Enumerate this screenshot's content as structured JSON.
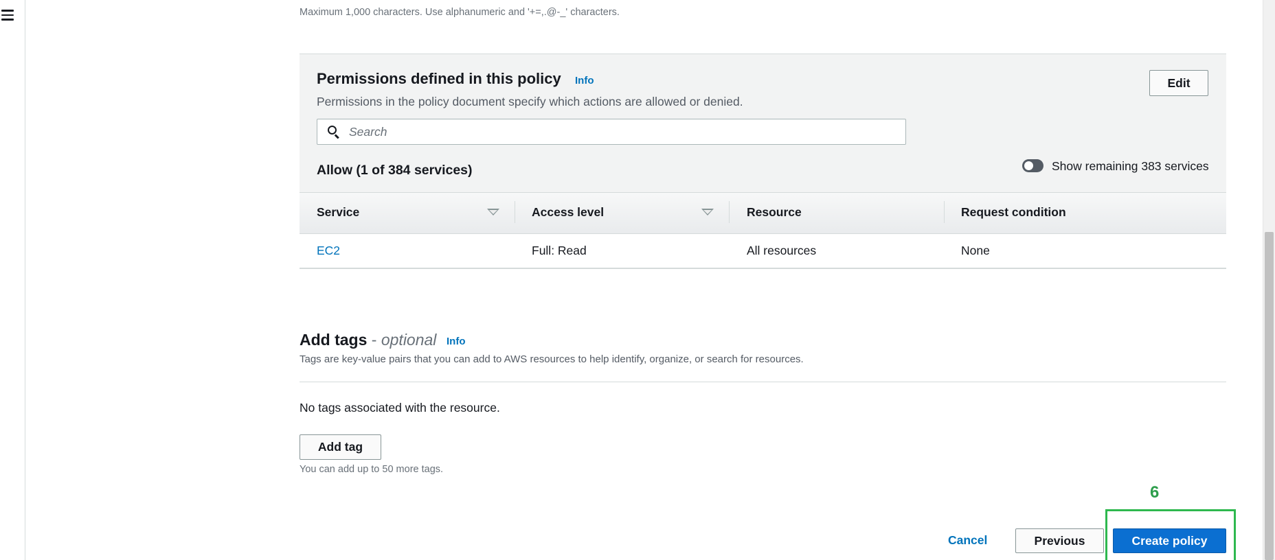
{
  "nav": {
    "menu_icon": "hamburger-menu-icon"
  },
  "description_hint": "Maximum 1,000 characters. Use alphanumeric and '+=,.@-_' characters.",
  "permissions": {
    "title": "Permissions defined in this policy",
    "info_label": "Info",
    "description": "Permissions in the policy document specify which actions are allowed or denied.",
    "edit_label": "Edit",
    "search_placeholder": "Search",
    "allow_title": "Allow (1 of 384 services)",
    "toggle_label": "Show remaining 383 services",
    "toggle_on": false,
    "table": {
      "columns": [
        "Service",
        "Access level",
        "Resource",
        "Request condition"
      ],
      "rows": [
        [
          "EC2",
          "Full: Read",
          "All resources",
          "None"
        ]
      ]
    }
  },
  "tags": {
    "title": "Add tags",
    "dash": " - ",
    "optional": "optional",
    "info_label": "Info",
    "description": "Tags are key-value pairs that you can add to AWS resources to help identify, organize, or search for resources.",
    "empty_text": "No tags associated with the resource.",
    "add_label": "Add tag",
    "limit_text": "You can add up to 50 more tags."
  },
  "footer": {
    "step_number": "6",
    "cancel_label": "Cancel",
    "previous_label": "Previous",
    "create_label": "Create policy"
  },
  "colors": {
    "link": "#0073bb",
    "primary": "#0b6fd1",
    "highlight": "#2eb84f"
  }
}
